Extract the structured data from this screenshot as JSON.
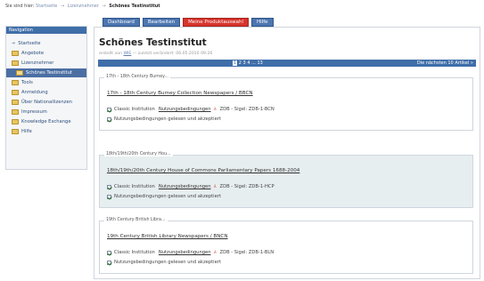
{
  "breadcrumb": {
    "prefix": "Sie sind hier:",
    "items": [
      "Startseite",
      "Lizenznehmer"
    ],
    "current": "Schönes Testinstitut",
    "separator": "→"
  },
  "sidebar": {
    "header": "Navigation",
    "items": [
      {
        "label": "Startseite",
        "icon": "arrow-icon"
      },
      {
        "label": "Angebote",
        "icon": "folder-icon"
      },
      {
        "label": "Lizenznehmer",
        "icon": "folder-icon"
      },
      {
        "label": "Schönes Testinstitut",
        "icon": "folder-open-icon",
        "active": true,
        "sub": true
      },
      {
        "label": "Tools",
        "icon": "folder-icon"
      },
      {
        "label": "Anmeldung",
        "icon": "folder-icon"
      },
      {
        "label": "Über Nationallizenzen",
        "icon": "folder-icon"
      },
      {
        "label": "Impressum",
        "icon": "folder-icon"
      },
      {
        "label": "Knowledge Exchange",
        "icon": "folder-icon"
      },
      {
        "label": "Hilfe",
        "icon": "folder-icon"
      }
    ]
  },
  "tabs": [
    {
      "label": "Dashboard"
    },
    {
      "label": "Bearbeiten"
    },
    {
      "label": "Meine Produktauswahl",
      "active": true
    },
    {
      "label": "Hilfe"
    }
  ],
  "main": {
    "title": "Schönes Testinstitut",
    "meta_prefix": "erstellt von",
    "meta_user": "WIE",
    "meta_suffix": "— zuletzt verändert: 06.05.2010 09:26",
    "pager": {
      "current": "1",
      "pages": "2 3 4 ... 13",
      "next": "Die nächsten 10 Artikel »"
    },
    "products": [
      {
        "legend": "17th - 18th Century Burney...",
        "title": "17th - 18th Century Burney Collection Newspapers / BBCN",
        "classic_label": "Classic Institution",
        "terms_link": "Nutzungsbedingungen",
        "zdb": "ZDB - Sigel: ZDB-1-BCN",
        "accepted": "Nutzungsbedingungen gelesen und akzeptiert"
      },
      {
        "legend": "18th/19th/20th Century Hou...",
        "title": "18th/19th/20th Century House of Commons Parliamentary Papers 1688-2004",
        "classic_label": "Classic Institution",
        "terms_link": "Nutzungsbedingungen",
        "zdb": "ZDB - Sigel: ZDB-1-HCP",
        "accepted": "Nutzungsbedingungen gelesen und akzeptiert"
      },
      {
        "legend": "19th Century British Libra...",
        "title": "19th Century British Library Newspapers / BNCN",
        "classic_label": "Classic Institution",
        "terms_link": "Nutzungsbedingungen",
        "zdb": "ZDB - Sigel: ZDB-1-BLN",
        "accepted": "Nutzungsbedingungen gelesen und akzeptiert"
      }
    ]
  },
  "colors": {
    "primary": "#3f6ea8",
    "active_tab": "#d6342c",
    "highlight_row": "#e7eef0"
  }
}
